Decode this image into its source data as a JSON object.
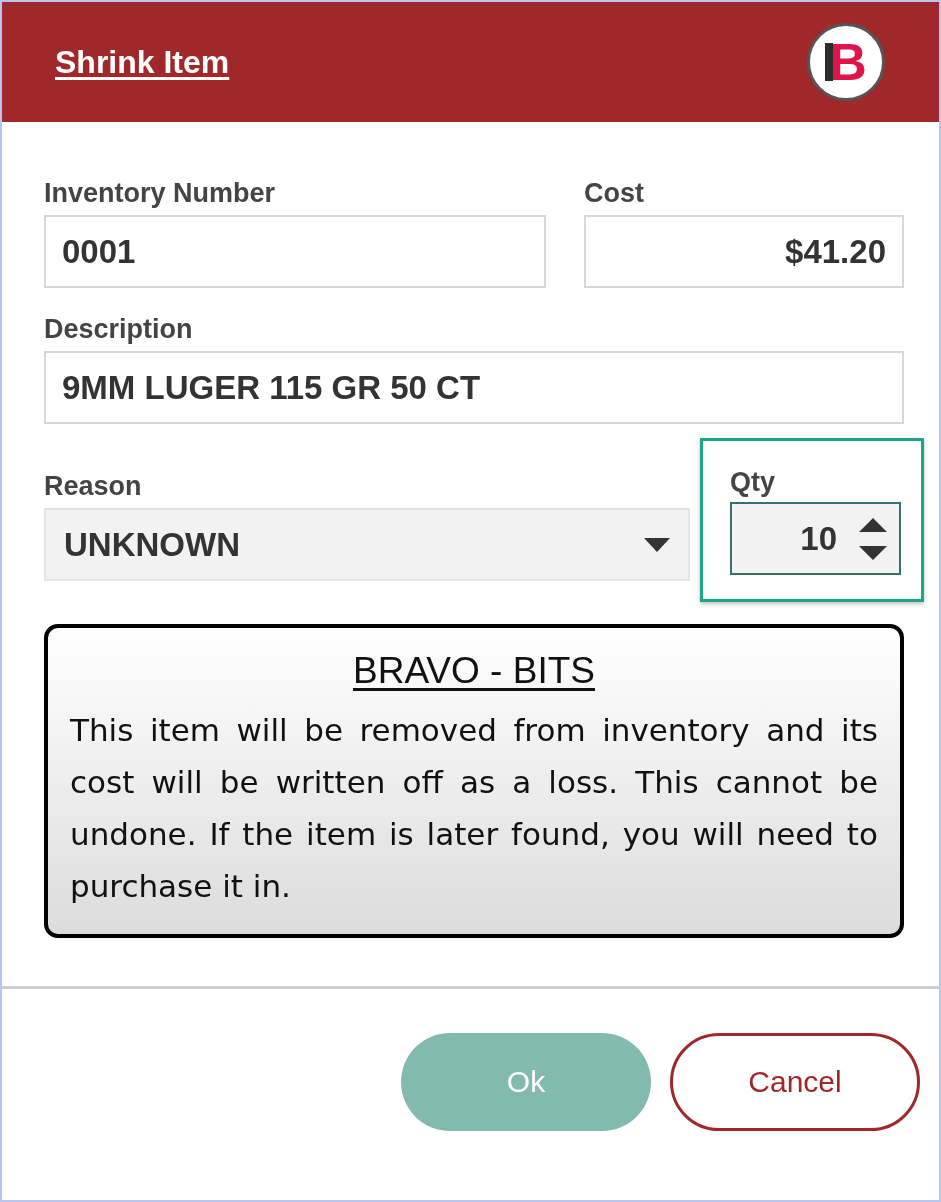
{
  "header": {
    "title": "Shrink Item",
    "logo": "B"
  },
  "fields": [
    {
      "label": "Inventory Number",
      "value": "0001"
    },
    {
      "label": "Cost",
      "value": "$41.20"
    }
  ],
  "description": {
    "label": "Description",
    "value": "9MM LUGER 115 GR 50 CT"
  },
  "reason": {
    "label": "Reason",
    "value": "UNKNOWN"
  },
  "qty": {
    "label": "Qty",
    "value": "10",
    "focused": true
  },
  "notice": {
    "title": "BRAVO - BITS",
    "text": "This item will be removed from inventory and its cost will be written off as a loss.  This cannot be undone.  If the item is later found, you will need to purchase it in."
  },
  "buttons": [
    {
      "label": "Ok",
      "kind": "primary"
    },
    {
      "label": "Cancel",
      "kind": "secondary"
    }
  ]
}
